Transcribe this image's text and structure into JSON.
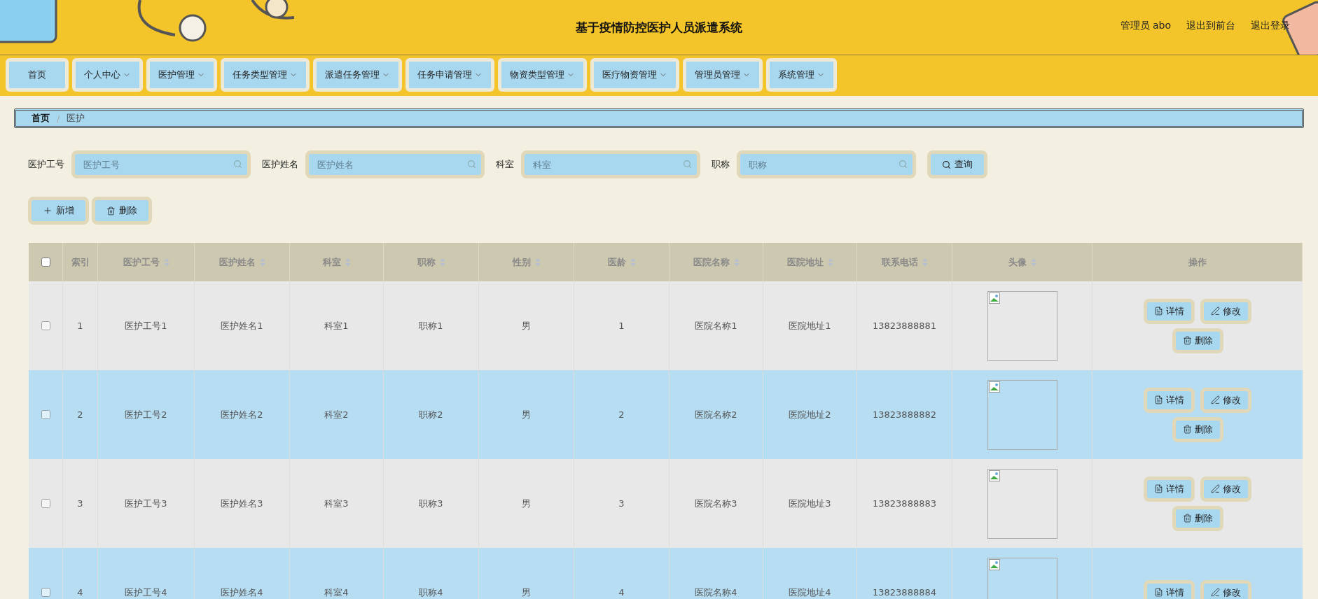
{
  "header": {
    "title": "基于疫情防控医护人员派遣系统",
    "user": "管理员 abo",
    "links": [
      "退出到前台",
      "退出登录"
    ]
  },
  "nav": [
    {
      "label": "首页",
      "dropdown": false
    },
    {
      "label": "个人中心",
      "dropdown": true
    },
    {
      "label": "医护管理",
      "dropdown": true
    },
    {
      "label": "任务类型管理",
      "dropdown": true
    },
    {
      "label": "派遣任务管理",
      "dropdown": true
    },
    {
      "label": "任务申请管理",
      "dropdown": true
    },
    {
      "label": "物资类型管理",
      "dropdown": true
    },
    {
      "label": "医疗物资管理",
      "dropdown": true
    },
    {
      "label": "管理员管理",
      "dropdown": true
    },
    {
      "label": "系统管理",
      "dropdown": true
    }
  ],
  "breadcrumb": [
    "首页",
    "医护"
  ],
  "breadcrumb_separator": "/",
  "search": {
    "fields": [
      {
        "label": "医护工号",
        "placeholder": "医护工号"
      },
      {
        "label": "医护姓名",
        "placeholder": "医护姓名"
      },
      {
        "label": "科室",
        "placeholder": "科室"
      },
      {
        "label": "职称",
        "placeholder": "职称"
      }
    ],
    "button": "查询"
  },
  "actions": [
    {
      "kind": "add",
      "label": "新增"
    },
    {
      "kind": "delete",
      "label": "删除"
    }
  ],
  "table": {
    "select_all": {
      "checked": false
    },
    "columns": [
      {
        "label": "索引",
        "sortable": false
      },
      {
        "label": "医护工号",
        "sortable": true
      },
      {
        "label": "医护姓名",
        "sortable": true
      },
      {
        "label": "科室",
        "sortable": true
      },
      {
        "label": "职称",
        "sortable": true
      },
      {
        "label": "性别",
        "sortable": true
      },
      {
        "label": "医龄",
        "sortable": true
      },
      {
        "label": "医院名称",
        "sortable": true
      },
      {
        "label": "医院地址",
        "sortable": true
      },
      {
        "label": "联系电话",
        "sortable": true
      },
      {
        "label": "头像",
        "sortable": true
      },
      {
        "label": "操作",
        "sortable": false
      }
    ],
    "rows": [
      {
        "checked": false,
        "cells": [
          "1",
          "医护工号1",
          "医护姓名1",
          "科室1",
          "职称1",
          "男",
          "1",
          "医院名称1",
          "医院地址1",
          "13823888881"
        ],
        "buttons": [
          {
            "kind": "detail",
            "label": "详情"
          },
          {
            "kind": "edit",
            "label": "修改"
          },
          {
            "kind": "delete",
            "label": "删除"
          }
        ]
      },
      {
        "checked": false,
        "cells": [
          "2",
          "医护工号2",
          "医护姓名2",
          "科室2",
          "职称2",
          "男",
          "2",
          "医院名称2",
          "医院地址2",
          "13823888882"
        ],
        "buttons": [
          {
            "kind": "detail",
            "label": "详情"
          },
          {
            "kind": "edit",
            "label": "修改"
          },
          {
            "kind": "delete",
            "label": "删除"
          }
        ]
      },
      {
        "checked": false,
        "cells": [
          "3",
          "医护工号3",
          "医护姓名3",
          "科室3",
          "职称3",
          "男",
          "3",
          "医院名称3",
          "医院地址3",
          "13823888883"
        ],
        "buttons": [
          {
            "kind": "detail",
            "label": "详情"
          },
          {
            "kind": "edit",
            "label": "修改"
          },
          {
            "kind": "delete",
            "label": "删除"
          }
        ]
      },
      {
        "checked": false,
        "cells": [
          "4",
          "医护工号4",
          "医护姓名4",
          "科室4",
          "职称4",
          "男",
          "4",
          "医院名称4",
          "医院地址4",
          "13823888884"
        ],
        "buttons": [
          {
            "kind": "detail",
            "label": "详情"
          },
          {
            "kind": "edit",
            "label": "修改"
          }
        ]
      }
    ]
  }
}
